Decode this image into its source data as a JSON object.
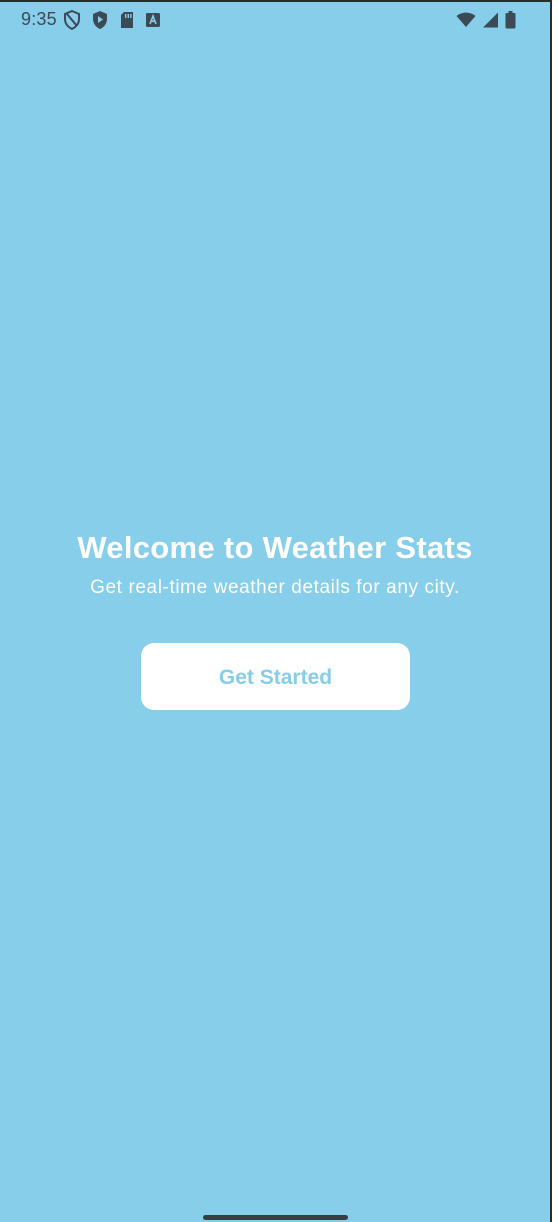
{
  "status_bar": {
    "time": "9:35",
    "left_icons": [
      "privacy-shield-icon",
      "play-shield-icon",
      "sd-card-icon",
      "keyboard-a-icon"
    ],
    "right_icons": [
      "wifi-icon",
      "cellular-signal-icon",
      "battery-icon"
    ]
  },
  "welcome": {
    "title": "Welcome to Weather Stats",
    "subtitle": "Get real-time weather details for any city."
  },
  "cta": {
    "label": "Get Started"
  },
  "colors": {
    "background": "#87CEEB",
    "button_background": "#FFFFFF",
    "button_text": "#86CDE9",
    "text_primary": "#FFFFFF",
    "status_icon": "#3B4A55"
  }
}
